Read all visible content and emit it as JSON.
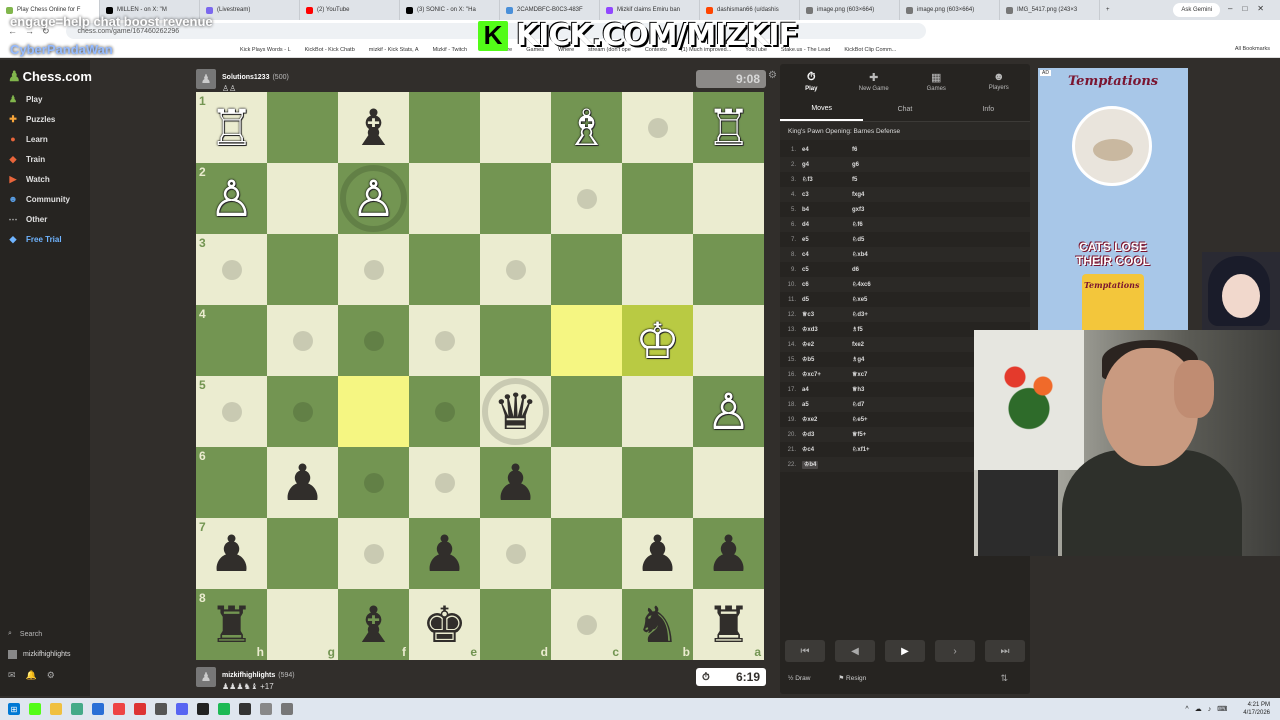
{
  "browser": {
    "tabs": [
      {
        "label": "Play Chess Online for F",
        "color": "#81b64c",
        "active": true
      },
      {
        "label": "MILLEN - on X: \"M",
        "color": "#000000"
      },
      {
        "label": "(Livestream)",
        "color": "#7b68ee"
      },
      {
        "label": "(2) YouTube",
        "color": "#ff0000"
      },
      {
        "label": "(3) SONIC - on X: \"Ha",
        "color": "#000000"
      },
      {
        "label": "2CAMDBFC-B0C3-483F",
        "color": "#4a90d9"
      },
      {
        "label": "Mizkif claims Emiru ban",
        "color": "#9147ff"
      },
      {
        "label": "dashisman66 (u/dashis",
        "color": "#ff4500"
      },
      {
        "label": "image.png (603×664)",
        "color": "#777777"
      },
      {
        "label": "image.png (603×664)",
        "color": "#777777"
      },
      {
        "label": "IMG_5417.png (243×3",
        "color": "#777777"
      }
    ],
    "ask_gemini": "Ask Gemini",
    "url": "chess.com/game/167460262296",
    "bookmarks": [
      "Kick Plays Words - L",
      "KickBot - Kick Chatb",
      "mizkif - Kick Stats, A",
      "Mizkif - Twitch",
      "Media Share",
      "Games",
      "Where",
      "stream (don't ope",
      "Contexto",
      "(1) Much improved...",
      "YouTube",
      "Stake.us - The Lead",
      "KickBot Clip Comm..."
    ],
    "all_bookmarks": "All Bookmarks"
  },
  "overlay": {
    "top_text": "",
    "mid_text": "engage=help chat boost revenue",
    "username": "CyberPandaWan",
    "kick_url": "KICK.COM/MIZKIF"
  },
  "sidenav": {
    "logo": "Chess.com",
    "items": [
      {
        "label": "Play",
        "icon": "play-icon",
        "glyph": "♟",
        "color": "#81b64c"
      },
      {
        "label": "Puzzles",
        "icon": "puzzle-icon",
        "glyph": "✚",
        "color": "#f7a53a"
      },
      {
        "label": "Learn",
        "icon": "learn-icon",
        "glyph": "●",
        "color": "#e8653b"
      },
      {
        "label": "Train",
        "icon": "train-icon",
        "glyph": "◆",
        "color": "#e8653b"
      },
      {
        "label": "Watch",
        "icon": "watch-icon",
        "glyph": "▶",
        "color": "#e8653b"
      },
      {
        "label": "Community",
        "icon": "community-icon",
        "glyph": "☻",
        "color": "#5aa0e8"
      },
      {
        "label": "Other",
        "icon": "more-icon",
        "glyph": "⋯",
        "color": "#bbbbbb"
      },
      {
        "label": "Free Trial",
        "icon": "diamond-icon",
        "glyph": "◆",
        "color": "#6fb4ff"
      }
    ],
    "search": "Search",
    "user": "mizkifhighlights"
  },
  "game": {
    "top_player": {
      "name": "Solutions1233",
      "rating": "(500)",
      "clock": "9:08",
      "captured": "♙♙"
    },
    "bottom_player": {
      "name": "mizkifhighlights",
      "rating": "(594)",
      "clock": "6:19",
      "captured": "♟♟♟♞♝ +17"
    },
    "ranks": [
      "1",
      "2",
      "3",
      "4",
      "5",
      "6",
      "7",
      "8"
    ],
    "files": [
      "h",
      "g",
      "f",
      "e",
      "d",
      "c",
      "b",
      "a"
    ],
    "board": [
      [
        "wR",
        "",
        "bB",
        "",
        "",
        "wB",
        "dot",
        "wR"
      ],
      [
        "wP",
        "",
        "wP+ring",
        "",
        "",
        "dot",
        "",
        ""
      ],
      [
        "dot",
        "",
        "dot",
        "",
        "dot",
        "",
        "",
        ""
      ],
      [
        "",
        "dot",
        "dot",
        "dot",
        "",
        "hl",
        "wK+hl",
        ""
      ],
      [
        "dot",
        "dot",
        "hl",
        "dot",
        "bQ+ring",
        "",
        "",
        "wP"
      ],
      [
        "",
        "bP",
        "dot",
        "dot",
        "bP",
        "",
        "",
        ""
      ],
      [
        "bP",
        "",
        "dot",
        "bP",
        "dot",
        "",
        "bP",
        "bP"
      ],
      [
        "bR",
        "",
        "bB",
        "bK",
        "",
        "dot",
        "bN",
        "bR"
      ]
    ]
  },
  "panel": {
    "tabs": [
      {
        "label": "Play",
        "glyph": "⏱",
        "icon": "play-clock-icon"
      },
      {
        "label": "New Game",
        "glyph": "✚",
        "icon": "new-game-icon"
      },
      {
        "label": "Games",
        "glyph": "▦",
        "icon": "games-icon"
      },
      {
        "label": "Players",
        "glyph": "☻",
        "icon": "players-icon"
      }
    ],
    "subtabs": [
      "Moves",
      "Chat",
      "Info"
    ],
    "opening": "King's Pawn Opening: Barnes Defense",
    "moves": [
      {
        "n": "1.",
        "w": "e4",
        "b": "f6"
      },
      {
        "n": "2.",
        "w": "g4",
        "b": "g6"
      },
      {
        "n": "3.",
        "w": "♘f3",
        "b": "f5"
      },
      {
        "n": "4.",
        "w": "c3",
        "b": "fxg4"
      },
      {
        "n": "5.",
        "w": "b4",
        "b": "gxf3"
      },
      {
        "n": "6.",
        "w": "d4",
        "b": "♘f6"
      },
      {
        "n": "7.",
        "w": "e5",
        "b": "♘d5"
      },
      {
        "n": "8.",
        "w": "c4",
        "b": "♘xb4"
      },
      {
        "n": "9.",
        "w": "c5",
        "b": "d6"
      },
      {
        "n": "10.",
        "w": "c6",
        "b": "♘4xc6"
      },
      {
        "n": "11.",
        "w": "d5",
        "b": "♘xe5"
      },
      {
        "n": "12.",
        "w": "♕c3",
        "b": "♘d3+"
      },
      {
        "n": "13.",
        "w": "♔xd3",
        "b": "♗f5"
      },
      {
        "n": "14.",
        "w": "♔e2",
        "b": "fxe2"
      },
      {
        "n": "15.",
        "w": "♔b5",
        "b": "♗g4"
      },
      {
        "n": "16.",
        "w": "♔xc7+",
        "b": "♕xc7"
      },
      {
        "n": "17.",
        "w": "a4",
        "b": "♕h3"
      },
      {
        "n": "18.",
        "w": "a5",
        "b": "♘d7"
      },
      {
        "n": "19.",
        "w": "♔xe2",
        "b": "♘e5+"
      },
      {
        "n": "20.",
        "w": "♔d3",
        "b": "♕f5+"
      },
      {
        "n": "21.",
        "w": "♔c4",
        "b": "♘xf1+"
      },
      {
        "n": "22.",
        "w": "♔b4",
        "b": ""
      }
    ],
    "footer": {
      "draw": "Draw",
      "resign": "Resign"
    }
  },
  "ad": {
    "tag": "AD",
    "brand": "Temptations",
    "line1": "CATS LOSE",
    "line2": "THEIR COOL"
  },
  "taskbar": {
    "time": "4:21 PM",
    "date": "4/17/2026"
  }
}
